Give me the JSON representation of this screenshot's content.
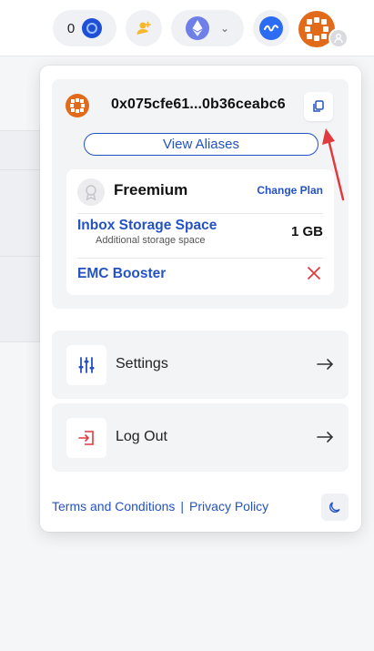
{
  "topbar": {
    "balance": "0",
    "coin_icon": "emc-coin-icon",
    "add_user_icon": "add-user-icon",
    "network_icon": "ethereum-icon",
    "wave_icon": "wave-icon",
    "accent": "#2452c4"
  },
  "account": {
    "address": "0x075cfe61...0b36ceabc6",
    "view_aliases_label": "View Aliases",
    "copy_icon": "copy-icon"
  },
  "plan": {
    "name": "Freemium",
    "change_label": "Change Plan",
    "storage_title": "Inbox Storage Space",
    "storage_subtitle": "Additional storage space",
    "storage_value": "1 GB",
    "booster_title": "EMC Booster",
    "booster_status_color": "#e0393e"
  },
  "menu": {
    "settings_label": "Settings",
    "logout_label": "Log Out",
    "logout_icon_color": "#e0393e"
  },
  "footer": {
    "terms_label": "Terms and Conditions",
    "separator": "|",
    "privacy_label": "Privacy Policy"
  }
}
